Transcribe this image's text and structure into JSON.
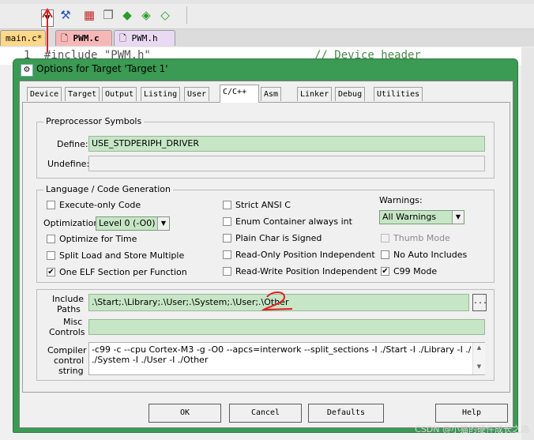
{
  "ide": {
    "file_tabs": [
      {
        "label": "main.c*"
      },
      {
        "label": "PWM.c"
      },
      {
        "label": "PWM.h"
      }
    ],
    "editor_line_number": "1",
    "editor_code": "#include \"PWM.h\"",
    "editor_comment": "// Device header"
  },
  "dialog": {
    "title": "Options for Target 'Target 1'",
    "tabs": [
      {
        "label": "Device"
      },
      {
        "label": "Target"
      },
      {
        "label": "Output"
      },
      {
        "label": "Listing"
      },
      {
        "label": "User"
      },
      {
        "label": "C/C++",
        "active": true
      },
      {
        "label": "Asm"
      },
      {
        "label": "Linker"
      },
      {
        "label": "Debug"
      },
      {
        "label": "Utilities"
      }
    ],
    "preprocessor": {
      "group_label": "Preprocessor Symbols",
      "define_label": "Define:",
      "define_value": "USE_STDPERIPH_DRIVER",
      "undefine_label": "Undefine:",
      "undefine_value": ""
    },
    "language": {
      "group_label": "Language / Code Generation",
      "execute_only": {
        "label": "Execute-only Code",
        "checked": false
      },
      "optimization_label": "Optimization:",
      "optimization_value": "Level 0 (-O0)",
      "optimize_time": {
        "label": "Optimize for Time",
        "checked": false
      },
      "split_load": {
        "label": "Split Load and Store Multiple",
        "checked": false
      },
      "one_elf": {
        "label": "One ELF Section per Function",
        "checked": true
      },
      "strict_ansi": {
        "label": "Strict ANSI C",
        "checked": false
      },
      "enum_container": {
        "label": "Enum Container always int",
        "checked": false
      },
      "plain_char": {
        "label": "Plain Char is Signed",
        "checked": false
      },
      "ro_pos": {
        "label": "Read-Only Position Independent",
        "checked": false
      },
      "rw_pos": {
        "label": "Read-Write Position Independent",
        "checked": false
      },
      "warnings_label": "Warnings:",
      "warnings_value": "All Warnings",
      "thumb_mode": {
        "label": "Thumb Mode",
        "checked": false,
        "disabled": true
      },
      "no_auto_includes": {
        "label": "No Auto Includes",
        "checked": false
      },
      "c99_mode": {
        "label": "C99 Mode",
        "checked": true
      }
    },
    "include_paths": {
      "label_line1": "Include",
      "label_line2": "Paths",
      "value": ".\\Start;.\\Library;.\\User;.\\System;.\\User;.\\Other",
      "browse_label": "..."
    },
    "misc_controls": {
      "label_line1": "Misc",
      "label_line2": "Controls",
      "value": ""
    },
    "compiler_control": {
      "label_line1": "Compiler",
      "label_line2": "control",
      "label_line3": "string",
      "line1": "-c99 -c --cpu Cortex-M3 -g -O0 --apcs=interwork --split_sections -I ./Start -I ./Library -I ./User -I",
      "line2": "./System -I ./User -I ./Other"
    },
    "buttons": {
      "ok": "OK",
      "cancel": "Cancel",
      "defaults": "Defaults",
      "help": "Help"
    }
  },
  "annotations": {
    "mark_2": "2"
  },
  "watermark": "CSDN @小猫的硬件成长之路",
  "colors": {
    "title_bar": "#3b9a53",
    "field_bg": "#c6e6c6",
    "annotation_red": "#e02020",
    "active_file_tab": "#f7b7b7",
    "modified_file_tab": "#ffd889"
  }
}
